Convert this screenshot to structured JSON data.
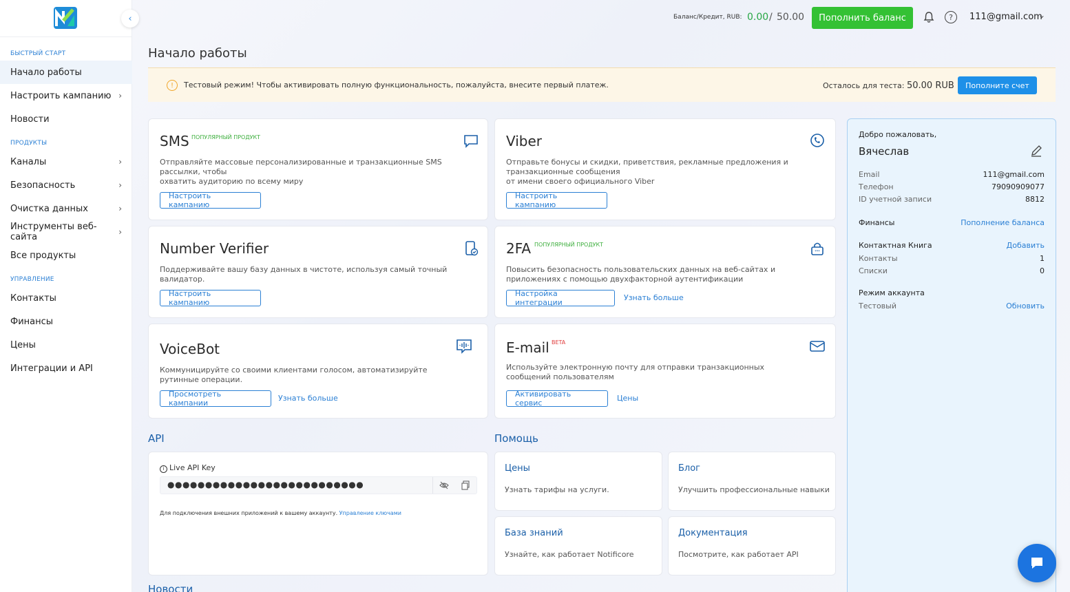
{
  "sidebar": {
    "collapse_icon": "chevron-left-icon",
    "sections": [
      {
        "title": "БЫСТРЫЙ СТАРТ",
        "items": [
          {
            "label": "Начало работы",
            "active": true,
            "chevron": false
          },
          {
            "label": "Настроить кампанию",
            "chevron": true
          },
          {
            "label": "Новости",
            "chevron": false
          }
        ]
      },
      {
        "title": "ПРОДУКТЫ",
        "items": [
          {
            "label": "Каналы",
            "chevron": true
          },
          {
            "label": "Безопасность",
            "chevron": true
          },
          {
            "label": "Очистка данных",
            "chevron": true
          },
          {
            "label": "Инструменты веб-сайта",
            "chevron": true
          },
          {
            "label": "Все продукты",
            "chevron": false
          }
        ]
      },
      {
        "title": "УПРАВЛЕНИЕ",
        "items": [
          {
            "label": "Контакты",
            "chevron": false
          },
          {
            "label": "Финансы",
            "chevron": false
          },
          {
            "label": "Цены",
            "chevron": false
          },
          {
            "label": "Интеграции и API",
            "chevron": false
          }
        ]
      }
    ]
  },
  "topbar": {
    "balance_label": "Баланс/Кредит, RUB:",
    "balance_value": "0.00",
    "separator": "/",
    "credit_limit": "50.00",
    "topup_label": "Пополнить баланс",
    "help_glyph": "?",
    "user_email": "111@gmail.com"
  },
  "page": {
    "title": "Начало работы"
  },
  "banner": {
    "message": "Тестовый режим! Чтобы активировать полную функциональность, пожалуйста, внесите первый платеж.",
    "remaining_label": "Осталось для теста:",
    "remaining_value": "50.00 RUB",
    "button_label": "Пополните счет"
  },
  "products": {
    "sms": {
      "title": "SMS",
      "badge": "ПОПУЛЯРНЫЙ ПРОДУКТ",
      "desc1": "Отправляйте массовые персонализированные и транзакционные SMS рассылки, чтобы",
      "desc2": "охватить аудиторию по всему миру",
      "button": "Настроить кампанию"
    },
    "viber": {
      "title": "Viber",
      "desc1": "Отправьте бонусы и скидки, приветствия, рекламные предложения и транзакционные сообщения",
      "desc2": "от имени своего официального Viber",
      "button": "Настроить кампанию"
    },
    "verifier": {
      "title": "Number Verifier",
      "desc1": "Поддерживайте вашу базу данных в чистоте, используя самый точный валидатор.",
      "button": "Настроить кампанию"
    },
    "twofa": {
      "title": "2FA",
      "badge": "ПОПУЛЯРНЫЙ ПРОДУКТ",
      "desc1": "Повысить безопасность пользовательских данных на веб-сайтах и приложениях с помощью двухфакторной аутентификации",
      "button": "Настройка интеграции",
      "link": "Узнать больше"
    },
    "voicebot": {
      "title": "VoiceBot",
      "desc1": "Коммуницируйте со своими клиентами голосом, автоматизируйте рутинные операции.",
      "button": "Просмотреть кампании",
      "link": "Узнать больше"
    },
    "email": {
      "title": "E-mail",
      "badge": "BETA",
      "desc1": "Используйте электронную почту для отправки транзакционных сообщений пользователям",
      "button": "Активировать сервис",
      "link": "Цены"
    }
  },
  "api": {
    "section_title": "API",
    "key_label": "Live API Key",
    "key_masked": "●●●●●●●●●●●●●●●●●●●●●●●●●●",
    "note": "Для подключения внешних приложений к вашему аккаунту.",
    "note_link": "Управление ключами"
  },
  "help": {
    "section_title": "Помощь",
    "cards": [
      {
        "title": "Цены",
        "desc": "Узнать тарифы на услуги."
      },
      {
        "title": "Блог",
        "desc": "Улучшить профессиональные навыки"
      },
      {
        "title": "База знаний",
        "desc": "Узнайте, как работает Notificore"
      },
      {
        "title": "Документация",
        "desc": "Посмотрите, как работает API"
      }
    ]
  },
  "news": {
    "section_title": "Новости"
  },
  "profile": {
    "welcome": "Добро пожаловать,",
    "name": "Вячеслав",
    "email_label": "Email",
    "email_value": "111@gmail.com",
    "phone_label": "Телефон",
    "phone_value": "79090909077",
    "id_label": "ID учетной записи",
    "id_value": "8812",
    "finance_label": "Финансы",
    "finance_link": "Пополнение баланса",
    "book_label": "Контактная Книга",
    "book_link": "Добавить",
    "contacts_label": "Контакты",
    "contacts_value": "1",
    "lists_label": "Списки",
    "lists_value": "0",
    "mode_label": "Режим аккаунта",
    "mode_value": "Тестовый",
    "mode_link": "Обновить"
  },
  "colors": {
    "accent": "#2a7fd4",
    "green": "#34c134",
    "banner_bg": "#fdf6e7",
    "profile_bg": "#e9f4fd"
  }
}
